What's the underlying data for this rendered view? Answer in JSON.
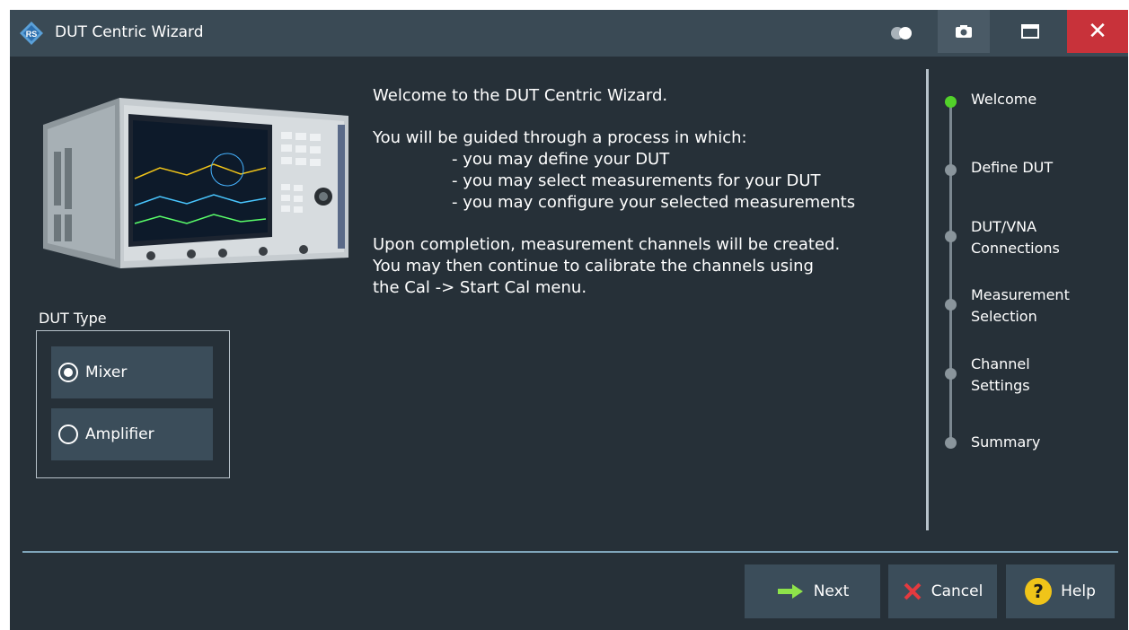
{
  "window": {
    "title": "DUT Centric Wizard"
  },
  "titlebar": {
    "buttons": [
      "toggle",
      "screenshot",
      "maximize",
      "close"
    ],
    "close_glyph": "✕"
  },
  "dut_type": {
    "label": "DUT Type",
    "options": [
      {
        "label": "Mixer",
        "selected": true
      },
      {
        "label": "Amplifier",
        "selected": false
      }
    ]
  },
  "intro": {
    "line1": "Welcome to the DUT Centric Wizard.",
    "line2": "You will be guided through a process in which:",
    "bullet1": "- you may define your DUT",
    "bullet2": "- you may select measurements for your DUT",
    "bullet3": "- you may configure your selected measurements",
    "line3": "Upon completion, measurement channels will be created.",
    "line4": "You may then continue to calibrate the channels using",
    "line5": "the Cal -> Start Cal menu."
  },
  "steps": [
    {
      "line1": "Welcome",
      "line2": "",
      "active": true
    },
    {
      "line1": "Define DUT",
      "line2": "",
      "active": false
    },
    {
      "line1": "DUT/VNA",
      "line2": "Connections",
      "active": false
    },
    {
      "line1": "Measurement",
      "line2": "Selection",
      "active": false
    },
    {
      "line1": "Channel",
      "line2": "Settings",
      "active": false
    },
    {
      "line1": "Summary",
      "line2": "",
      "active": false
    }
  ],
  "footer": {
    "next": "Next",
    "cancel": "Cancel",
    "help": "Help",
    "help_glyph": "?"
  },
  "colors": {
    "background": "#263038",
    "titlebar": "#3a4a55",
    "active_step": "#52d22a",
    "close": "#c8323a"
  }
}
